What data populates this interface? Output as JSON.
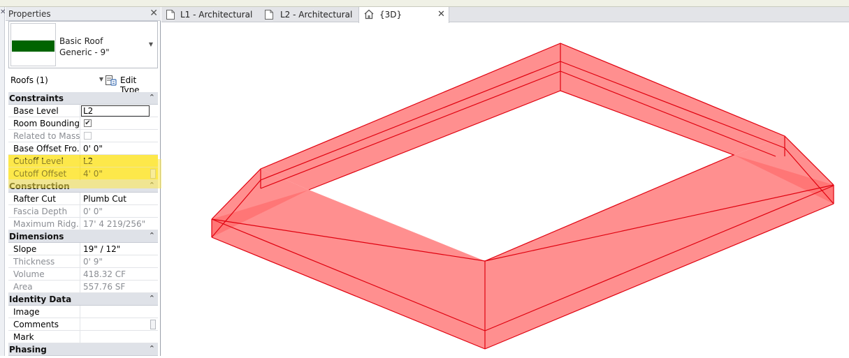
{
  "properties": {
    "title": "Properties",
    "type_selector": {
      "family": "Basic Roof",
      "type": "Generic - 9\"",
      "preview_color": "#006400"
    },
    "filter_value": "Roofs (1)",
    "edit_type_label": "Edit Type",
    "sections": {
      "constraints": {
        "title": "Constraints",
        "base_level": {
          "label": "Base Level",
          "value": "L2"
        },
        "room_bounding": {
          "label": "Room Bounding"
        },
        "related_to_mass": {
          "label": "Related to Mass"
        },
        "base_offset": {
          "label": "Base Offset Fro...",
          "value": "0'  0\""
        },
        "cutoff_level": {
          "label": "Cutoff Level",
          "value": "L2"
        },
        "cutoff_offset": {
          "label": "Cutoff Offset",
          "value": "4'  0\""
        }
      },
      "construction": {
        "title": "Construction",
        "rafter_cut": {
          "label": "Rafter Cut",
          "value": "Plumb Cut"
        },
        "fascia_depth": {
          "label": "Fascia Depth",
          "value": "0'  0\""
        },
        "max_ridge": {
          "label": "Maximum Ridg...",
          "value": "17'  4 219/256\""
        }
      },
      "dimensions": {
        "title": "Dimensions",
        "slope": {
          "label": "Slope",
          "value": "19\" / 12\""
        },
        "thickness": {
          "label": "Thickness",
          "value": "0'  9\""
        },
        "volume": {
          "label": "Volume",
          "value": "418.32 CF"
        },
        "area": {
          "label": "Area",
          "value": "557.76 SF"
        }
      },
      "identity": {
        "title": "Identity Data",
        "image": {
          "label": "Image"
        },
        "comments": {
          "label": "Comments"
        },
        "mark": {
          "label": "Mark"
        }
      },
      "phasing": {
        "title": "Phasing"
      }
    }
  },
  "tabs": [
    {
      "label": "L1 - Architectural"
    },
    {
      "label": "L2 - Architectural"
    },
    {
      "label": "{3D}"
    }
  ],
  "colors": {
    "highlight": "#fde84a",
    "roof_fill": "#ff6f6f",
    "roof_edge": "#e0000e"
  },
  "icons": {
    "view_tab": "sheet-icon",
    "active_view": "home-3d-icon",
    "edit_type": "edit-type-icon",
    "close": "close-icon",
    "collapse": "chevron-double-up-icon"
  }
}
